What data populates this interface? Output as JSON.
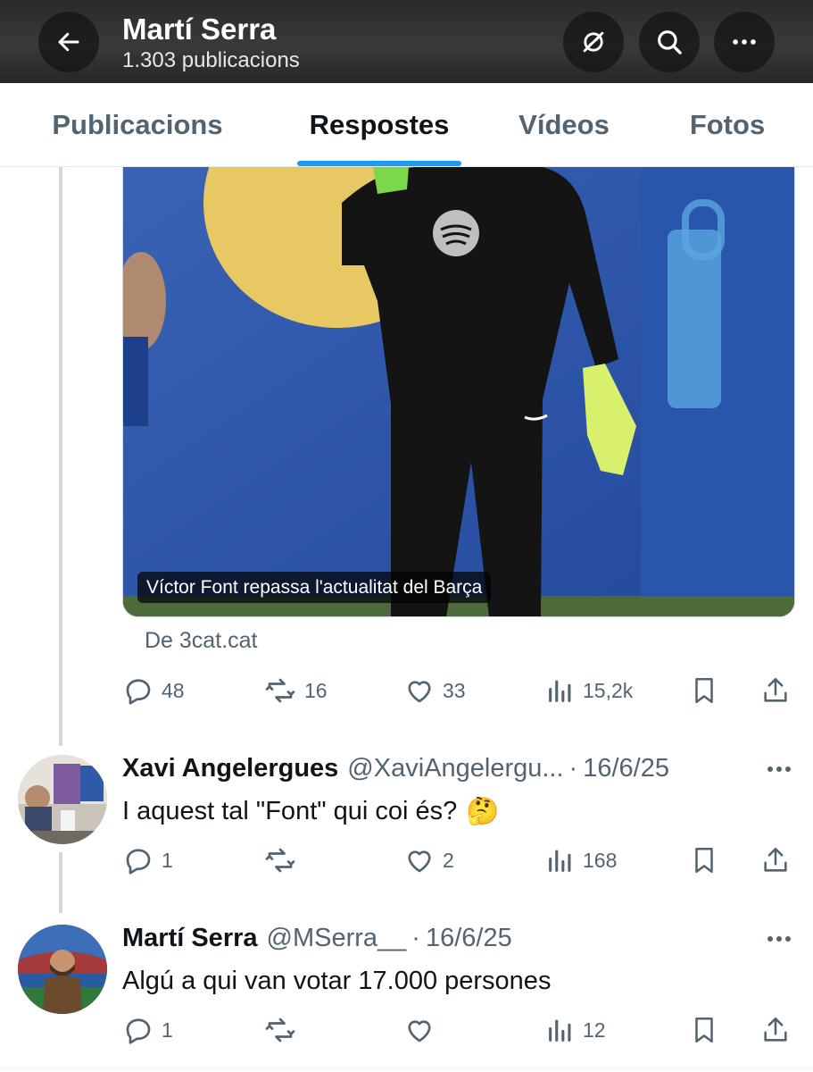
{
  "header": {
    "title": "Martí Serra",
    "subtitle": "1.303 publicacions"
  },
  "tabs": [
    {
      "label": "Publicacions",
      "active": false
    },
    {
      "label": "Respostes",
      "active": true
    },
    {
      "label": "Vídeos",
      "active": false
    },
    {
      "label": "Fotos",
      "active": false
    }
  ],
  "colors": {
    "accent": "#1d9bf0",
    "muted": "#536471",
    "text": "#0f1419"
  },
  "media_card": {
    "caption": "Víctor Font repassa l'actualitat del Barça",
    "source": "De 3cat.cat"
  },
  "tweet_actions": {
    "replies": "48",
    "retweets": "16",
    "likes": "33",
    "views": "15,2k"
  },
  "replies": [
    {
      "name": "Xavi Angelergues",
      "handle": "@XaviAngelergu...",
      "separator": "·",
      "date": "16/6/25",
      "text": "I aquest tal \"Font\" qui coi és?",
      "emoji": "🤔",
      "actions": {
        "replies": "1",
        "retweets": "",
        "likes": "2",
        "views": "168"
      }
    },
    {
      "name": "Martí Serra",
      "handle": "@MSerra__",
      "separator": "·",
      "date": "16/6/25",
      "text": "Algú a qui van votar 17.000 persones",
      "actions": {
        "replies": "1",
        "retweets": "",
        "likes": "",
        "views": "12"
      }
    }
  ],
  "icons": [
    "back-arrow-icon",
    "no-notifications-icon",
    "search-icon",
    "more-icon",
    "reply-icon",
    "retweet-icon",
    "like-icon",
    "views-icon",
    "bookmark-icon",
    "share-icon"
  ]
}
